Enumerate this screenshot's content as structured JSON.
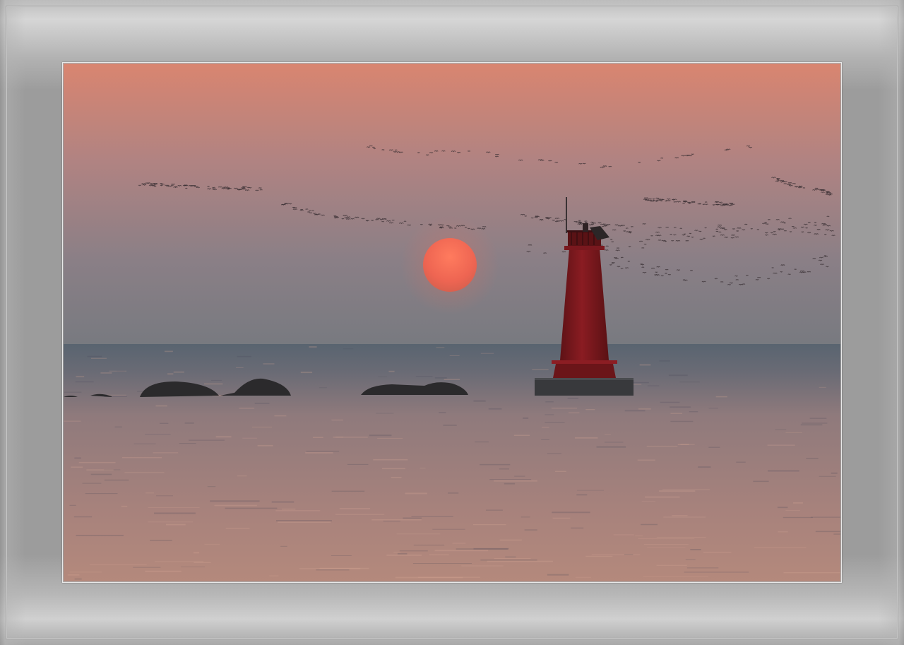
{
  "scene": {
    "subject": "lighthouse-at-sunset",
    "colors": {
      "sky_top": "#d98a72",
      "sky_mid": "#a98684",
      "sky_horizon": "#7b7b80",
      "sea_far": "#5c6570",
      "sea_near": "#b0857b",
      "sun": "#f06a55",
      "lighthouse": "#7d1a1e",
      "frame": "#9c9c9c"
    }
  }
}
